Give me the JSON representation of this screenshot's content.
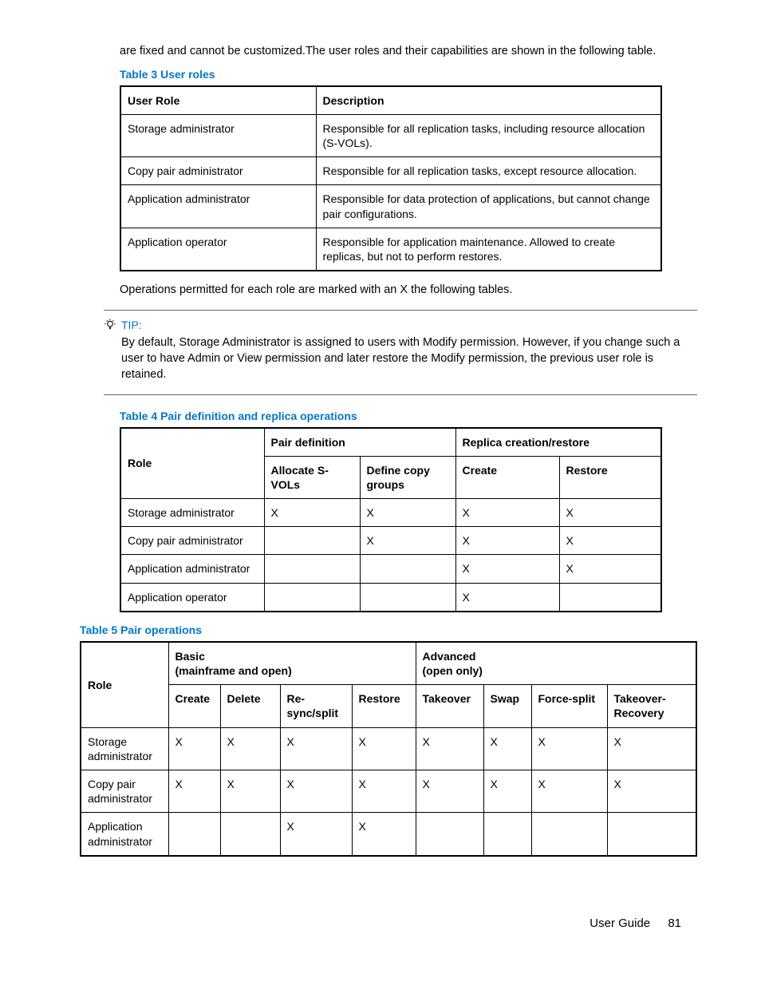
{
  "intro": "are fixed and cannot be customized.The user roles and their capabilities are shown in the following table.",
  "table3": {
    "caption": "Table 3 User roles",
    "headers": [
      "User Role",
      "Description"
    ],
    "rows": [
      [
        "Storage administrator",
        "Responsible for all replication tasks, including resource allocation (S-VOLs)."
      ],
      [
        "Copy pair administrator",
        "Responsible for all replication tasks, except resource allocation."
      ],
      [
        "Application administrator",
        "Responsible for data protection of applications, but cannot change pair configurations."
      ],
      [
        "Application operator",
        "Responsible for application maintenance. Allowed to create replicas, but not to perform restores."
      ]
    ]
  },
  "midtext": "Operations permitted for each role are marked with an X the following tables.",
  "tip": {
    "label": "TIP:",
    "body": "By default, Storage Administrator is assigned to users with Modify permission. However, if you change such a user to have Admin or View permission and later restore the Modify permission, the previous user role is retained."
  },
  "table4": {
    "caption": "Table 4 Pair definition and replica operations",
    "group1": "Pair definition",
    "group2": "Replica creation/restore",
    "rolehdr": "Role",
    "subheaders": [
      "Allocate S-VOLs",
      "Define copy groups",
      "Create",
      "Restore"
    ],
    "rows": [
      [
        "Storage administrator",
        "X",
        "X",
        "X",
        "X"
      ],
      [
        "Copy pair administrator",
        "",
        "X",
        "X",
        "X"
      ],
      [
        "Application administrator",
        "",
        "",
        "X",
        "X"
      ],
      [
        "Application operator",
        "",
        "",
        "X",
        ""
      ]
    ]
  },
  "table5": {
    "caption": "Table 5 Pair operations",
    "group1label": "Basic",
    "group1sub": "(mainframe and open)",
    "group2label": "Advanced",
    "group2sub": "(open only)",
    "rolehdr": "Role",
    "subheaders": [
      "Create",
      "Delete",
      "Re-sync/split",
      "Restore",
      "Takeover",
      "Swap",
      "Force-split",
      "Takeover-Recovery"
    ],
    "rows": [
      [
        "Storage administrator",
        "X",
        "X",
        "X",
        "X",
        "X",
        "X",
        "X",
        "X"
      ],
      [
        "Copy pair administrator",
        "X",
        "X",
        "X",
        "X",
        "X",
        "X",
        "X",
        "X"
      ],
      [
        "Application administrator",
        "",
        "",
        "X",
        "X",
        "",
        "",
        "",
        ""
      ]
    ]
  },
  "footer": {
    "label": "User Guide",
    "page": "81"
  }
}
